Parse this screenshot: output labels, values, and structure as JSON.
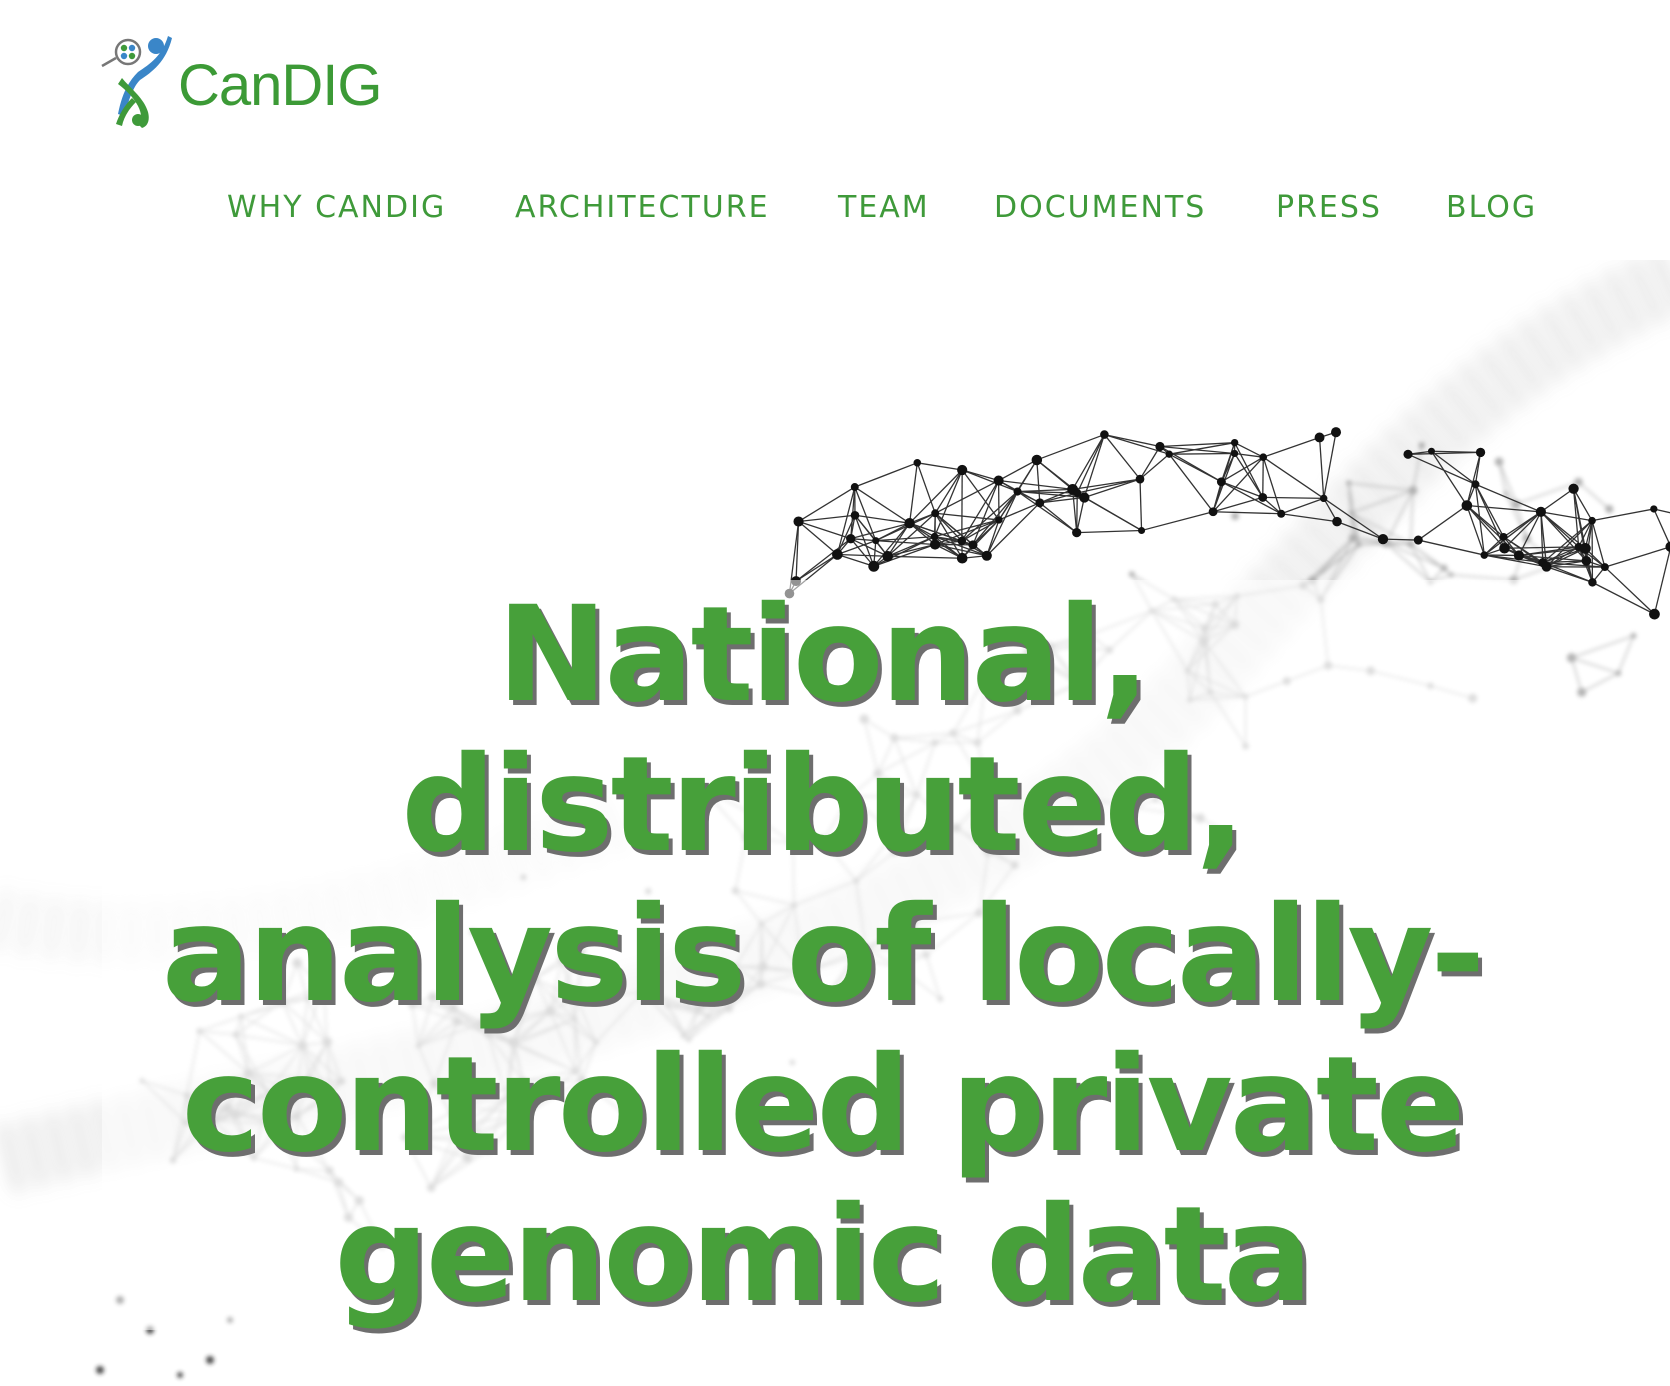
{
  "brand": {
    "name": "CanDIG",
    "color": "#3c9a36",
    "icon": "candig-logo-icon"
  },
  "nav": {
    "items": [
      {
        "label": "WHY CANDIG"
      },
      {
        "label": "ARCHITECTURE"
      },
      {
        "label": "TEAM"
      },
      {
        "label": "DOCUMENTS"
      },
      {
        "label": "PRESS"
      },
      {
        "label": "BLOG"
      }
    ],
    "color": "#3f9a3a"
  },
  "hero": {
    "title_lines": [
      "National,",
      "distributed,",
      "analysis of locally-",
      "controlled private",
      "genomic data"
    ],
    "title_color": "#47a03a",
    "background": "network-graph-image"
  }
}
